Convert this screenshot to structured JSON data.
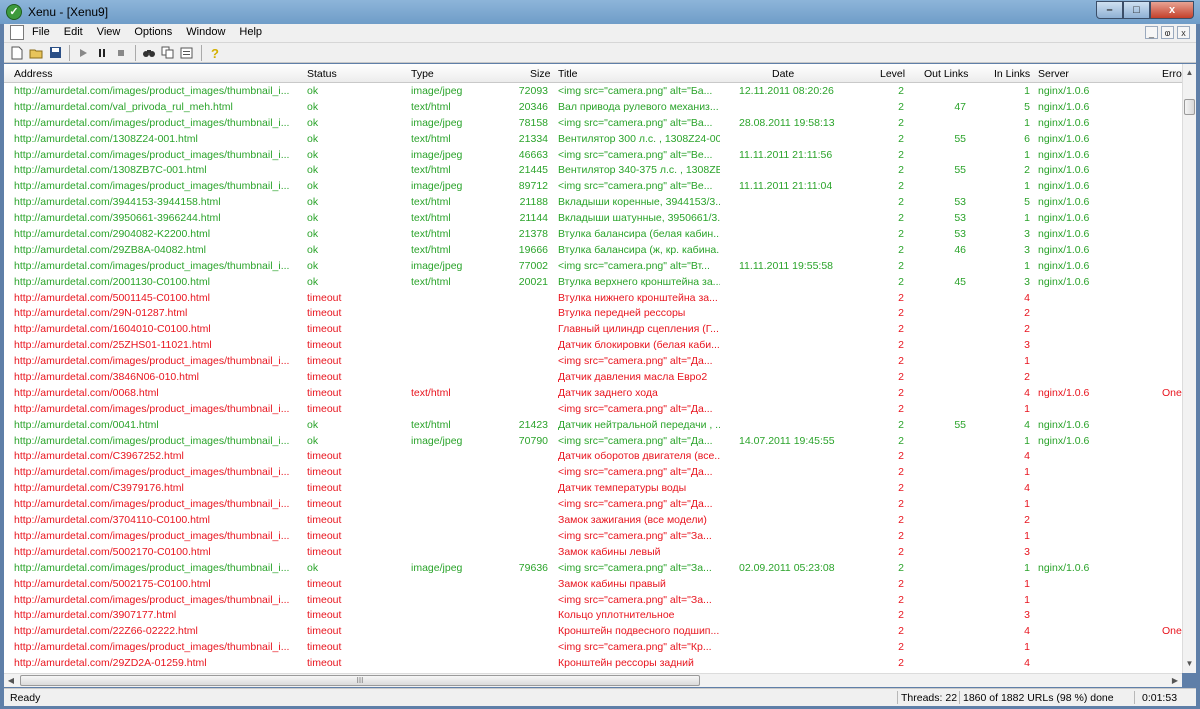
{
  "window": {
    "title": "Xenu - [Xenu9]",
    "app_icon": "xenu-logo-icon",
    "minimize": "–",
    "maximize": "□",
    "close": "x"
  },
  "menu": {
    "items": [
      "File",
      "Edit",
      "View",
      "Options",
      "Window",
      "Help"
    ]
  },
  "mdi": {
    "minimize": "_",
    "restore": "ⱷ",
    "close": "x"
  },
  "toolbar": {
    "buttons": [
      "new-icon",
      "open-icon",
      "save-icon",
      "play-icon",
      "pause-icon",
      "stop-icon",
      "find-icon",
      "copy-icon",
      "properties-icon",
      "help-icon"
    ]
  },
  "table": {
    "columns": [
      "Address",
      "Status",
      "Type",
      "Size",
      "Title",
      "Date",
      "Level",
      "Out Links",
      "In Links",
      "Server",
      "Erro"
    ],
    "rows": [
      {
        "address": "http://amurdetal.com/images/product_images/thumbnail_i...",
        "status": "ok",
        "type": "image/jpeg",
        "size": "72093",
        "title": "<img src=\"camera.png\" alt=\"Ба...",
        "date": "12.11.2011  08:20:26",
        "level": "2",
        "out": "",
        "in": "1",
        "server": "nginx/1.0.6",
        "error": "",
        "state": "ok"
      },
      {
        "address": "http://amurdetal.com/val_privoda_rul_meh.html",
        "status": "ok",
        "type": "text/html",
        "size": "20346",
        "title": "Вал привода рулевого механиз...",
        "date": "",
        "level": "2",
        "out": "47",
        "in": "5",
        "server": "nginx/1.0.6",
        "error": "",
        "state": "ok"
      },
      {
        "address": "http://amurdetal.com/images/product_images/thumbnail_i...",
        "status": "ok",
        "type": "image/jpeg",
        "size": "78158",
        "title": "<img src=\"camera.png\" alt=\"Ва...",
        "date": "28.08.2011  19:58:13",
        "level": "2",
        "out": "",
        "in": "1",
        "server": "nginx/1.0.6",
        "error": "",
        "state": "ok"
      },
      {
        "address": "http://amurdetal.com/1308Z24-001.html",
        "status": "ok",
        "type": "text/html",
        "size": "21334",
        "title": "Вентилятор 300 л.с. , 1308Z24-00...",
        "date": "",
        "level": "2",
        "out": "55",
        "in": "6",
        "server": "nginx/1.0.6",
        "error": "",
        "state": "ok"
      },
      {
        "address": "http://amurdetal.com/images/product_images/thumbnail_i...",
        "status": "ok",
        "type": "image/jpeg",
        "size": "46663",
        "title": "<img src=\"camera.png\" alt=\"Ве...",
        "date": "11.11.2011  21:11:56",
        "level": "2",
        "out": "",
        "in": "1",
        "server": "nginx/1.0.6",
        "error": "",
        "state": "ok"
      },
      {
        "address": "http://amurdetal.com/1308ZB7C-001.html",
        "status": "ok",
        "type": "text/html",
        "size": "21445",
        "title": "Вентилятор 340-375 л.с. , 1308ZB...",
        "date": "",
        "level": "2",
        "out": "55",
        "in": "2",
        "server": "nginx/1.0.6",
        "error": "",
        "state": "ok"
      },
      {
        "address": "http://amurdetal.com/images/product_images/thumbnail_i...",
        "status": "ok",
        "type": "image/jpeg",
        "size": "89712",
        "title": "<img src=\"camera.png\" alt=\"Ве...",
        "date": "11.11.2011  21:11:04",
        "level": "2",
        "out": "",
        "in": "1",
        "server": "nginx/1.0.6",
        "error": "",
        "state": "ok"
      },
      {
        "address": "http://amurdetal.com/3944153-3944158.html",
        "status": "ok",
        "type": "text/html",
        "size": "21188",
        "title": "Вкладыши коренные, 3944153/3...",
        "date": "",
        "level": "2",
        "out": "53",
        "in": "5",
        "server": "nginx/1.0.6",
        "error": "",
        "state": "ok"
      },
      {
        "address": "http://amurdetal.com/3950661-3966244.html",
        "status": "ok",
        "type": "text/html",
        "size": "21144",
        "title": "Вкладыши шатунные, 3950661/3...",
        "date": "",
        "level": "2",
        "out": "53",
        "in": "1",
        "server": "nginx/1.0.6",
        "error": "",
        "state": "ok"
      },
      {
        "address": "http://amurdetal.com/2904082-K2200.html",
        "status": "ok",
        "type": "text/html",
        "size": "21378",
        "title": "Втулка балансира (белая кабин...",
        "date": "",
        "level": "2",
        "out": "53",
        "in": "3",
        "server": "nginx/1.0.6",
        "error": "",
        "state": "ok"
      },
      {
        "address": "http://amurdetal.com/29ZB8A-04082.html",
        "status": "ok",
        "type": "text/html",
        "size": "19666",
        "title": "Втулка балансира (ж, кр. кабина...",
        "date": "",
        "level": "2",
        "out": "46",
        "in": "3",
        "server": "nginx/1.0.6",
        "error": "",
        "state": "ok"
      },
      {
        "address": "http://amurdetal.com/images/product_images/thumbnail_i...",
        "status": "ok",
        "type": "image/jpeg",
        "size": "77002",
        "title": "<img src=\"camera.png\" alt=\"Вт...",
        "date": "11.11.2011  19:55:58",
        "level": "2",
        "out": "",
        "in": "1",
        "server": "nginx/1.0.6",
        "error": "",
        "state": "ok"
      },
      {
        "address": "http://amurdetal.com/2001130-C0100.html",
        "status": "ok",
        "type": "text/html",
        "size": "20021",
        "title": "Втулка верхнего кронштейна за...",
        "date": "",
        "level": "2",
        "out": "45",
        "in": "3",
        "server": "nginx/1.0.6",
        "error": "",
        "state": "ok"
      },
      {
        "address": "http://amurdetal.com/5001145-C0100.html",
        "status": "timeout",
        "type": "",
        "size": "",
        "title": "Втулка нижнего кронштейна за...",
        "date": "",
        "level": "2",
        "out": "",
        "in": "4",
        "server": "",
        "error": "",
        "state": "err"
      },
      {
        "address": "http://amurdetal.com/29N-01287.html",
        "status": "timeout",
        "type": "",
        "size": "",
        "title": "Втулка передней рессоры",
        "date": "",
        "level": "2",
        "out": "",
        "in": "2",
        "server": "",
        "error": "",
        "state": "err"
      },
      {
        "address": "http://amurdetal.com/1604010-C0100.html",
        "status": "timeout",
        "type": "",
        "size": "",
        "title": "Главный цилиндр сцепления (Г...",
        "date": "",
        "level": "2",
        "out": "",
        "in": "2",
        "server": "",
        "error": "",
        "state": "err"
      },
      {
        "address": "http://amurdetal.com/25ZHS01-11021.html",
        "status": "timeout",
        "type": "",
        "size": "",
        "title": "Датчик блокировки (белая каби...",
        "date": "",
        "level": "2",
        "out": "",
        "in": "3",
        "server": "",
        "error": "",
        "state": "err"
      },
      {
        "address": "http://amurdetal.com/images/product_images/thumbnail_i...",
        "status": "timeout",
        "type": "",
        "size": "",
        "title": "<img src=\"camera.png\" alt=\"Да...",
        "date": "",
        "level": "2",
        "out": "",
        "in": "1",
        "server": "",
        "error": "",
        "state": "err"
      },
      {
        "address": "http://amurdetal.com/3846N06-010.html",
        "status": "timeout",
        "type": "",
        "size": "",
        "title": "Датчик давления масла Евро2",
        "date": "",
        "level": "2",
        "out": "",
        "in": "2",
        "server": "",
        "error": "",
        "state": "err"
      },
      {
        "address": "http://amurdetal.com/0068.html",
        "status": "timeout",
        "type": "text/html",
        "size": "",
        "title": "Датчик заднего хода",
        "date": "",
        "level": "2",
        "out": "",
        "in": "4",
        "server": "nginx/1.0.6",
        "error": "One",
        "state": "err"
      },
      {
        "address": "http://amurdetal.com/images/product_images/thumbnail_i...",
        "status": "timeout",
        "type": "",
        "size": "",
        "title": "<img src=\"camera.png\" alt=\"Да...",
        "date": "",
        "level": "2",
        "out": "",
        "in": "1",
        "server": "",
        "error": "",
        "state": "err"
      },
      {
        "address": "http://amurdetal.com/0041.html",
        "status": "ok",
        "type": "text/html",
        "size": "21423",
        "title": "Датчик нейтральной передачи , ...",
        "date": "",
        "level": "2",
        "out": "55",
        "in": "4",
        "server": "nginx/1.0.6",
        "error": "",
        "state": "ok"
      },
      {
        "address": "http://amurdetal.com/images/product_images/thumbnail_i...",
        "status": "ok",
        "type": "image/jpeg",
        "size": "70790",
        "title": "<img src=\"camera.png\" alt=\"Да...",
        "date": "14.07.2011  19:45:55",
        "level": "2",
        "out": "",
        "in": "1",
        "server": "nginx/1.0.6",
        "error": "",
        "state": "ok"
      },
      {
        "address": "http://amurdetal.com/C3967252.html",
        "status": "timeout",
        "type": "",
        "size": "",
        "title": "Датчик оборотов двигателя (все...",
        "date": "",
        "level": "2",
        "out": "",
        "in": "4",
        "server": "",
        "error": "",
        "state": "err"
      },
      {
        "address": "http://amurdetal.com/images/product_images/thumbnail_i...",
        "status": "timeout",
        "type": "",
        "size": "",
        "title": "<img src=\"camera.png\" alt=\"Да...",
        "date": "",
        "level": "2",
        "out": "",
        "in": "1",
        "server": "",
        "error": "",
        "state": "err"
      },
      {
        "address": "http://amurdetal.com/C3979176.html",
        "status": "timeout",
        "type": "",
        "size": "",
        "title": "Датчик температуры воды",
        "date": "",
        "level": "2",
        "out": "",
        "in": "4",
        "server": "",
        "error": "",
        "state": "err"
      },
      {
        "address": "http://amurdetal.com/images/product_images/thumbnail_i...",
        "status": "timeout",
        "type": "",
        "size": "",
        "title": "<img src=\"camera.png\" alt=\"Да...",
        "date": "",
        "level": "2",
        "out": "",
        "in": "1",
        "server": "",
        "error": "",
        "state": "err"
      },
      {
        "address": "http://amurdetal.com/3704110-C0100.html",
        "status": "timeout",
        "type": "",
        "size": "",
        "title": "Замок зажигания (все модели)",
        "date": "",
        "level": "2",
        "out": "",
        "in": "2",
        "server": "",
        "error": "",
        "state": "err"
      },
      {
        "address": "http://amurdetal.com/images/product_images/thumbnail_i...",
        "status": "timeout",
        "type": "",
        "size": "",
        "title": "<img src=\"camera.png\" alt=\"За...",
        "date": "",
        "level": "2",
        "out": "",
        "in": "1",
        "server": "",
        "error": "",
        "state": "err"
      },
      {
        "address": "http://amurdetal.com/5002170-C0100.html",
        "status": "timeout",
        "type": "",
        "size": "",
        "title": "Замок кабины левый",
        "date": "",
        "level": "2",
        "out": "",
        "in": "3",
        "server": "",
        "error": "",
        "state": "err"
      },
      {
        "address": "http://amurdetal.com/images/product_images/thumbnail_i...",
        "status": "ok",
        "type": "image/jpeg",
        "size": "79636",
        "title": "<img src=\"camera.png\" alt=\"За...",
        "date": "02.09.2011  05:23:08",
        "level": "2",
        "out": "",
        "in": "1",
        "server": "nginx/1.0.6",
        "error": "",
        "state": "ok"
      },
      {
        "address": "http://amurdetal.com/5002175-C0100.html",
        "status": "timeout",
        "type": "",
        "size": "",
        "title": "Замок кабины правый",
        "date": "",
        "level": "2",
        "out": "",
        "in": "1",
        "server": "",
        "error": "",
        "state": "err"
      },
      {
        "address": "http://amurdetal.com/images/product_images/thumbnail_i...",
        "status": "timeout",
        "type": "",
        "size": "",
        "title": "<img src=\"camera.png\" alt=\"За...",
        "date": "",
        "level": "2",
        "out": "",
        "in": "1",
        "server": "",
        "error": "",
        "state": "err"
      },
      {
        "address": "http://amurdetal.com/3907177.html",
        "status": "timeout",
        "type": "",
        "size": "",
        "title": "Кольцо уплотнительное",
        "date": "",
        "level": "2",
        "out": "",
        "in": "3",
        "server": "",
        "error": "",
        "state": "err"
      },
      {
        "address": "http://amurdetal.com/22Z66-02222.html",
        "status": "timeout",
        "type": "",
        "size": "",
        "title": "Кронштейн подвесного подшип...",
        "date": "",
        "level": "2",
        "out": "",
        "in": "4",
        "server": "",
        "error": "One",
        "state": "err"
      },
      {
        "address": "http://amurdetal.com/images/product_images/thumbnail_i...",
        "status": "timeout",
        "type": "",
        "size": "",
        "title": "<img src=\"camera.png\" alt=\"Кр...",
        "date": "",
        "level": "2",
        "out": "",
        "in": "1",
        "server": "",
        "error": "",
        "state": "err"
      },
      {
        "address": "http://amurdetal.com/29ZD2A-01259.html",
        "status": "timeout",
        "type": "",
        "size": "",
        "title": "Кронштейн рессоры задний",
        "date": "",
        "level": "2",
        "out": "",
        "in": "4",
        "server": "",
        "error": "",
        "state": "err"
      }
    ]
  },
  "colors": {
    "ok": "#2aa32a",
    "error": "#e8141e"
  },
  "scroll": {
    "thumb_grip": "III"
  },
  "statusbar": {
    "left": "Ready",
    "threads": "Threads: 22",
    "progress": "1860 of 1882 URLs (98 %) done",
    "elapsed": "0:01:53"
  }
}
